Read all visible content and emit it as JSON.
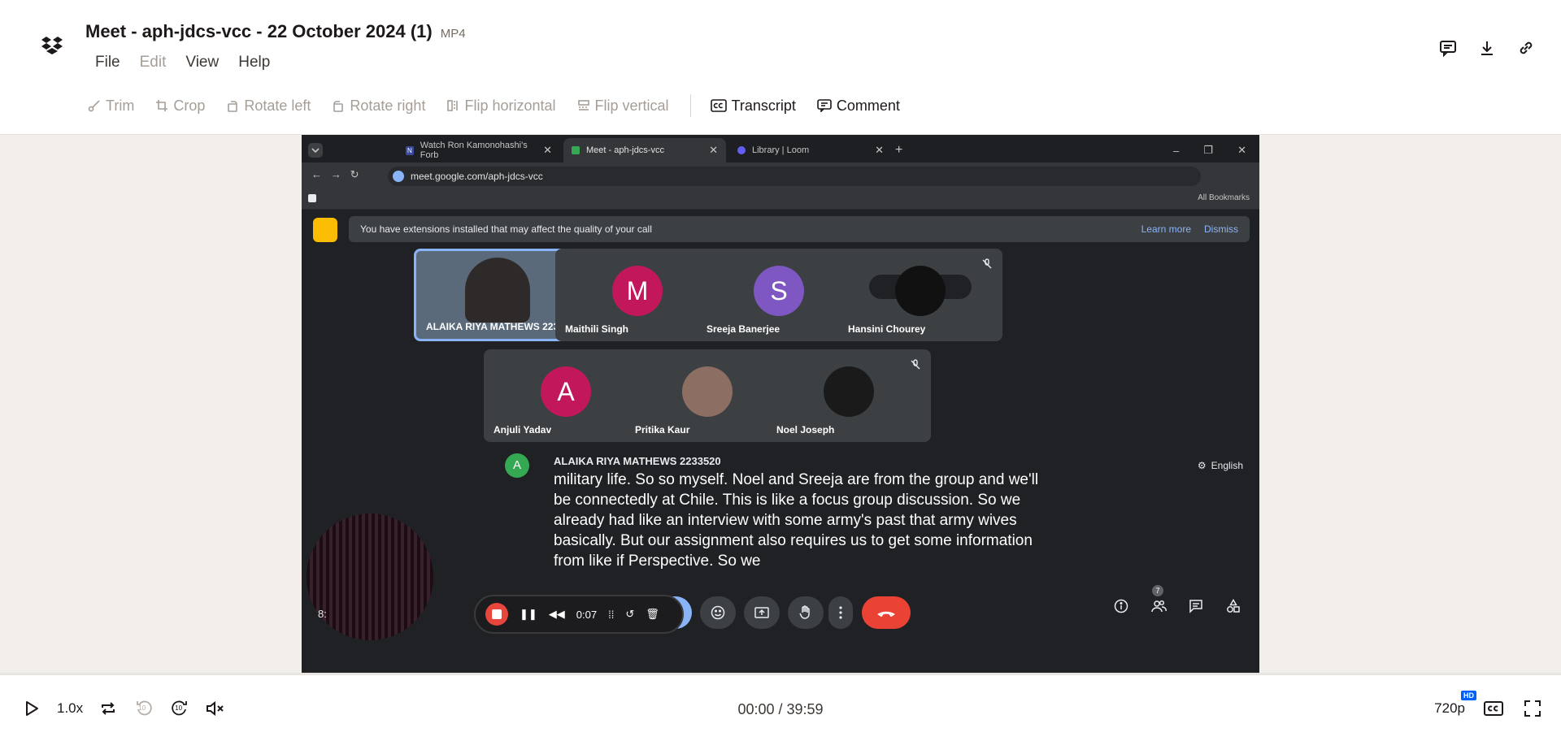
{
  "file": {
    "title": "Meet - aph-jdcs-vcc - 22 October 2024 (1)",
    "type": "MP4"
  },
  "menu": [
    "File",
    "Edit",
    "View",
    "Help"
  ],
  "toolbar": {
    "trim": "Trim",
    "crop": "Crop",
    "rotate_left": "Rotate left",
    "rotate_right": "Rotate right",
    "flip_horizontal": "Flip horizontal",
    "flip_vertical": "Flip vertical",
    "transcript": "Transcript",
    "comment": "Comment"
  },
  "video": {
    "tabs": [
      "Watch Ron Kamonohashi's Forb",
      "Meet - aph-jdcs-vcc",
      "Library | Loom"
    ],
    "url": "meet.google.com/aph-jdcs-vcc",
    "bookmarks_label": "All Bookmarks",
    "banner": {
      "text": "You have extensions installed that may affect the quality of your call",
      "learn_more": "Learn more",
      "dismiss": "Dismiss"
    },
    "participants": [
      {
        "name": "ALAIKA RIYA MATHEWS 2233...",
        "initial": "",
        "color": "#5b6a7a"
      },
      {
        "name": "Maithili Singh",
        "initial": "M",
        "color": "#c2185b"
      },
      {
        "name": "Sreeja Banerjee",
        "initial": "S",
        "color": "#7e57c2"
      },
      {
        "name": "Hansini Chourey",
        "initial": "",
        "color": "#111111"
      },
      {
        "name": "Anjuli Yadav",
        "initial": "A",
        "color": "#c2185b"
      },
      {
        "name": "Pritika Kaur",
        "initial": "",
        "color": "#8d6e63"
      },
      {
        "name": "Noel Joseph",
        "initial": "",
        "color": "#1a1a1a"
      }
    ],
    "caption": {
      "avatar": "A",
      "speaker": "ALAIKA RIYA MATHEWS 2233520",
      "text": "military life. So so myself. Noel and Sreeja are from the group and we'll be connectedly at Chile. This is like a focus group discussion. So we already had like an interview with some army's past that army wives basically. But our assignment also requires us to get some information from like if Perspective. So we"
    },
    "language": "English",
    "recorder_time": "0:07",
    "clock_stub": "8:",
    "people_count": "7"
  },
  "player": {
    "speed": "1.0x",
    "skip_back": "10",
    "skip_forward": "10",
    "time": "00:00 / 39:59",
    "quality": "720p",
    "hd_badge": "HD",
    "progress": 0.0
  },
  "colors": {
    "brand": "#0061fe",
    "stage_bg": "#f2efea",
    "meet_bg": "#202124"
  }
}
